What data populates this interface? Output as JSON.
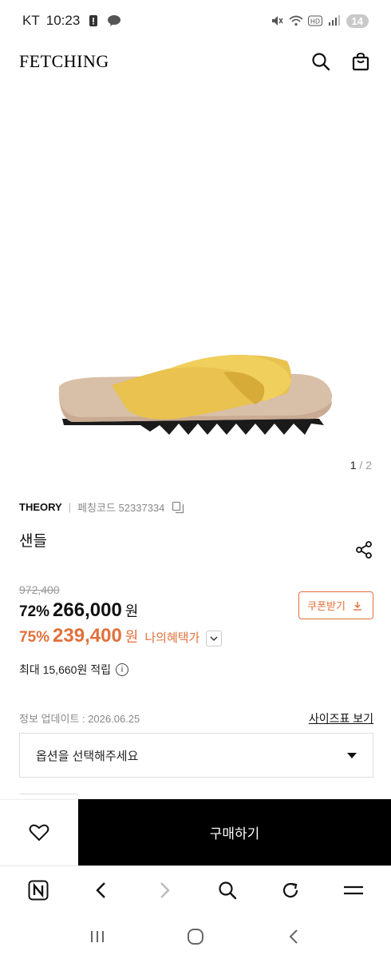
{
  "status_bar": {
    "carrier": "KT",
    "time": "10:23",
    "battery_level": "14"
  },
  "header": {
    "logo": "FETCHING"
  },
  "gallery": {
    "current": "1",
    "separator": "/",
    "total": "2"
  },
  "product": {
    "brand": "THEORY",
    "code_label": "페칭코드 52337334",
    "name": "샌들"
  },
  "price": {
    "original": "972,400",
    "discount_percent": "72%",
    "sale_price": "266,000",
    "currency": "원",
    "benefit_percent": "75%",
    "benefit_price": "239,400",
    "benefit_label": "나의혜택가",
    "coupon_label": "쿠폰받기",
    "points_text": "최대 15,660원 적립"
  },
  "info": {
    "update_text": "정보 업데이트 : 2026.06.25",
    "size_chart_link": "사이즈표 보기"
  },
  "option": {
    "placeholder": "옵션을 선택해주세요"
  },
  "buy_bar": {
    "buy_label": "구매하기"
  },
  "colors": {
    "accent": "#e2703a",
    "buy_button": "#000000"
  }
}
